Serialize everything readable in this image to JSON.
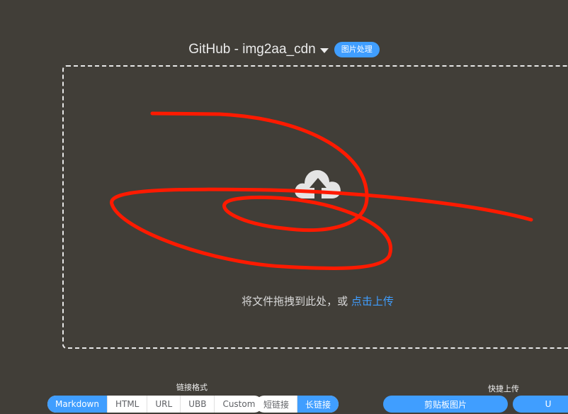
{
  "header": {
    "title": "GitHub - img2aa_cdn",
    "image_process_label": "图片处理"
  },
  "upload": {
    "drop_text": "将文件拖拽到此处，或",
    "click_upload_link": "点击上传"
  },
  "link_format": {
    "label": "链接格式",
    "options": [
      "Markdown",
      "HTML",
      "URL",
      "UBB",
      "Custom"
    ],
    "selected": "Markdown",
    "link_length": {
      "options": [
        "短链接",
        "长链接"
      ],
      "selected": "长链接"
    }
  },
  "quick_upload": {
    "label": "快捷上传",
    "clipboard_button": "剪贴板图片",
    "url_button": "U"
  },
  "colors": {
    "accent": "#409eff",
    "background": "#413e38",
    "scribble": "#ff1a00"
  },
  "icons": {
    "upload": "cloud-upload-icon",
    "dropdown": "caret-down-icon"
  }
}
